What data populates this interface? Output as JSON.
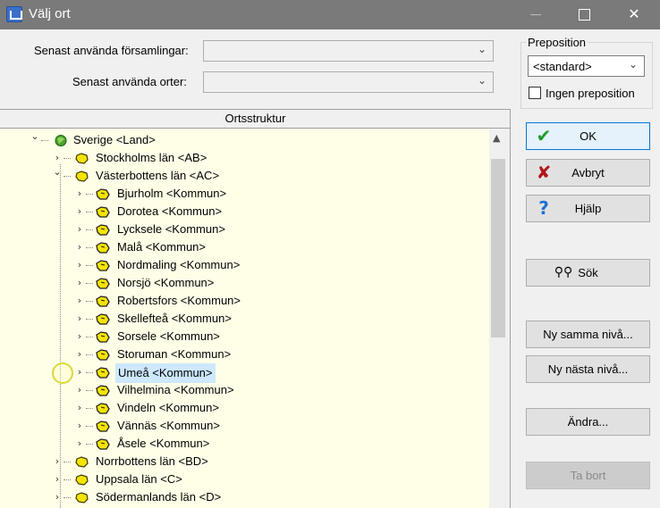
{
  "window": {
    "title": "Välj ort",
    "minimize": "—",
    "maximize": "",
    "close": "✕"
  },
  "form": {
    "recent_parishes_label": "Senast använda församlingar:",
    "recent_parishes_value": "",
    "recent_places_label": "Senast använda orter:",
    "recent_places_value": ""
  },
  "preposition": {
    "group_title": "Preposition",
    "selected": "<standard>",
    "no_preposition_label": "Ingen preposition",
    "no_preposition_checked": false
  },
  "tree": {
    "header": "Ortsstruktur",
    "nodes": [
      {
        "label": "Sverige <Land>",
        "level": 0,
        "state": "expanded",
        "icon": "globe-icon",
        "selected": false
      },
      {
        "label": "Stockholms län <AB>",
        "level": 1,
        "state": "collapsed",
        "icon": "county-icon",
        "selected": false
      },
      {
        "label": "Västerbottens län <AC>",
        "level": 1,
        "state": "expanded",
        "icon": "county-icon",
        "selected": false
      },
      {
        "label": "Bjurholm <Kommun>",
        "level": 2,
        "state": "collapsed",
        "icon": "municipality-icon",
        "selected": false
      },
      {
        "label": "Dorotea <Kommun>",
        "level": 2,
        "state": "collapsed",
        "icon": "municipality-icon",
        "selected": false
      },
      {
        "label": "Lycksele <Kommun>",
        "level": 2,
        "state": "collapsed",
        "icon": "municipality-icon",
        "selected": false
      },
      {
        "label": "Malå <Kommun>",
        "level": 2,
        "state": "collapsed",
        "icon": "municipality-icon",
        "selected": false
      },
      {
        "label": "Nordmaling <Kommun>",
        "level": 2,
        "state": "collapsed",
        "icon": "municipality-icon",
        "selected": false
      },
      {
        "label": "Norsjö <Kommun>",
        "level": 2,
        "state": "collapsed",
        "icon": "municipality-icon",
        "selected": false
      },
      {
        "label": "Robertsfors <Kommun>",
        "level": 2,
        "state": "collapsed",
        "icon": "municipality-icon",
        "selected": false
      },
      {
        "label": "Skellefteå <Kommun>",
        "level": 2,
        "state": "collapsed",
        "icon": "municipality-icon",
        "selected": false
      },
      {
        "label": "Sorsele <Kommun>",
        "level": 2,
        "state": "collapsed",
        "icon": "municipality-icon",
        "selected": false
      },
      {
        "label": "Storuman <Kommun>",
        "level": 2,
        "state": "collapsed",
        "icon": "municipality-icon",
        "selected": false
      },
      {
        "label": "Umeå <Kommun>",
        "level": 2,
        "state": "collapsed",
        "icon": "municipality-icon",
        "selected": true
      },
      {
        "label": "Vilhelmina <Kommun>",
        "level": 2,
        "state": "collapsed",
        "icon": "municipality-icon",
        "selected": false
      },
      {
        "label": "Vindeln <Kommun>",
        "level": 2,
        "state": "collapsed",
        "icon": "municipality-icon",
        "selected": false
      },
      {
        "label": "Vännäs <Kommun>",
        "level": 2,
        "state": "collapsed",
        "icon": "municipality-icon",
        "selected": false
      },
      {
        "label": "Åsele <Kommun>",
        "level": 2,
        "state": "collapsed",
        "icon": "municipality-icon",
        "selected": false
      },
      {
        "label": "Norrbottens län <BD>",
        "level": 1,
        "state": "collapsed",
        "icon": "county-icon",
        "selected": false
      },
      {
        "label": "Uppsala län <C>",
        "level": 1,
        "state": "collapsed",
        "icon": "county-icon",
        "selected": false
      },
      {
        "label": "Södermanlands län <D>",
        "level": 1,
        "state": "collapsed",
        "icon": "county-icon",
        "selected": false
      }
    ]
  },
  "buttons": {
    "ok": "OK",
    "cancel": "Avbryt",
    "help": "Hjälp",
    "search": "Sök",
    "new_same_level": "Ny samma nivå...",
    "new_next_level": "Ny nästa nivå...",
    "edit": "Ändra...",
    "delete": "Ta bort"
  },
  "colors": {
    "title_bar": "#7a7a7a",
    "tree_background": "#ffffe8",
    "selection": "#cde8ff",
    "ok_icon": "#1f9a2a",
    "cancel_icon": "#b01818",
    "help_icon": "#1f6fd0",
    "globe_icon": "#4aa32a",
    "municipality_icon": "#f5e300"
  }
}
